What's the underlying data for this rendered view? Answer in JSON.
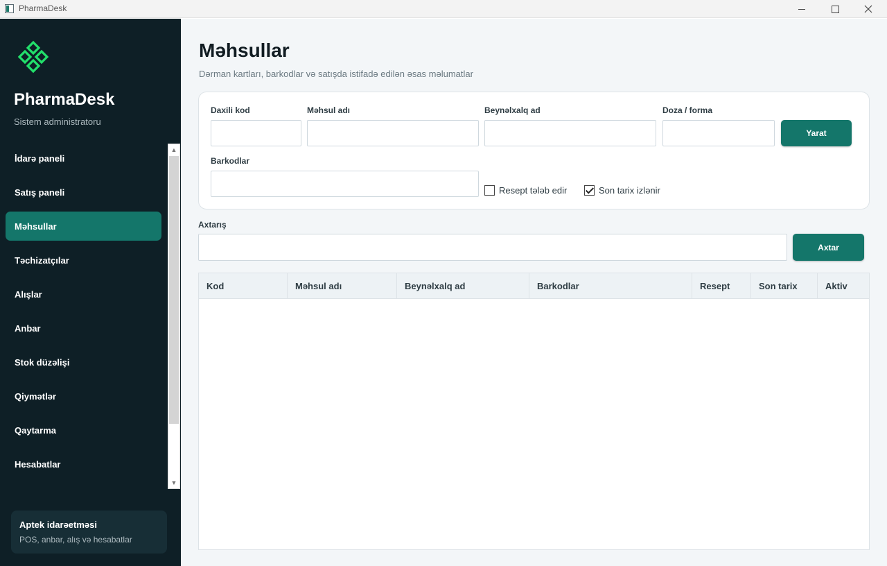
{
  "window": {
    "title": "PharmaDesk"
  },
  "sidebar": {
    "brand": "PharmaDesk",
    "role": "Sistem administratoru",
    "items": [
      {
        "label": "İdarə paneli",
        "active": false
      },
      {
        "label": "Satış paneli",
        "active": false
      },
      {
        "label": "Məhsullar",
        "active": true
      },
      {
        "label": "Təchizatçılar",
        "active": false
      },
      {
        "label": "Alışlar",
        "active": false
      },
      {
        "label": "Anbar",
        "active": false
      },
      {
        "label": "Stok düzəlişi",
        "active": false
      },
      {
        "label": "Qiymətlər",
        "active": false
      },
      {
        "label": "Qaytarma",
        "active": false
      },
      {
        "label": "Hesabatlar",
        "active": false
      }
    ],
    "footer": {
      "title": "Aptek idarəetməsi",
      "subtitle": "POS, anbar, alış və hesabatlar"
    }
  },
  "page": {
    "title": "Məhsullar",
    "subtitle": "Dərman kartları, barkodlar və satışda istifadə edilən əsas məlumatlar"
  },
  "form": {
    "internal_code": {
      "label": "Daxili kod",
      "value": ""
    },
    "product_name": {
      "label": "Məhsul adı",
      "value": ""
    },
    "international_name": {
      "label": "Beynəlxalq ad",
      "value": ""
    },
    "dose_form": {
      "label": "Doza / forma",
      "value": ""
    },
    "barcodes": {
      "label": "Barkodlar",
      "value": ""
    },
    "create_label": "Yarat",
    "prescription_required": {
      "label": "Resept tələb edir",
      "checked": false
    },
    "expiry_tracked": {
      "label": "Son tarix izlənir",
      "checked": true
    }
  },
  "search": {
    "label": "Axtarış",
    "value": "",
    "button_label": "Axtar"
  },
  "table": {
    "columns": [
      "Kod",
      "Məhsul adı",
      "Beynəlxalq ad",
      "Barkodlar",
      "Resept",
      "Son tarix",
      "Aktiv"
    ],
    "rows": []
  },
  "colors": {
    "sidebar_bg": "#0e1f26",
    "accent": "#14766a",
    "logo_green": "#22e06b"
  },
  "icons": {
    "logo": "diamond-cluster-logo-icon",
    "checkbox_checked": "checkmark-icon"
  }
}
